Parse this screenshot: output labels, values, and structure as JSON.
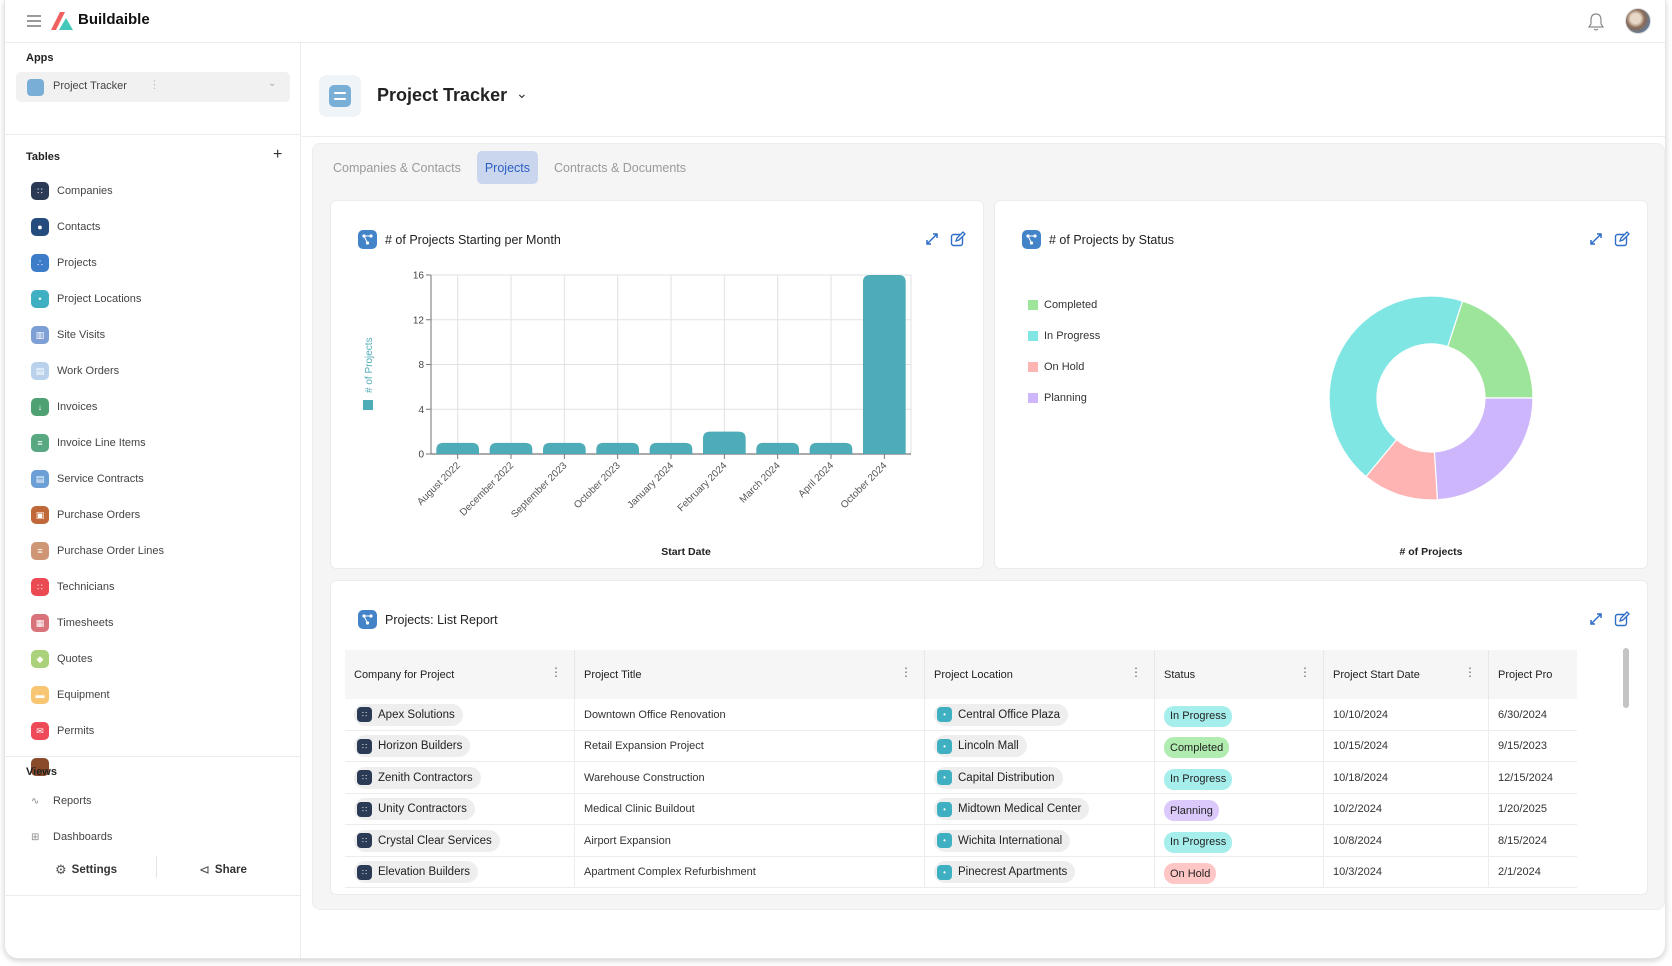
{
  "app": {
    "brand": "Buildaible",
    "colors": {
      "brand_red": "#f06060",
      "brand_teal": "#46c7bb",
      "accent": "#2f6ec6",
      "bar": "#4eabb8"
    }
  },
  "sidebar": {
    "apps_label": "Apps",
    "app_selector": {
      "label": "Project Tracker",
      "icon": "database-icon"
    },
    "tables_label": "Tables",
    "tables": [
      {
        "label": "Companies",
        "icon": "users-icon",
        "color": "#2b3a55",
        "glyph": "∷"
      },
      {
        "label": "Contacts",
        "icon": "person-icon",
        "color": "#244d7e",
        "glyph": "●"
      },
      {
        "label": "Projects",
        "icon": "diagram-icon",
        "color": "#3d7cc9",
        "glyph": "∴"
      },
      {
        "label": "Project Locations",
        "icon": "pin-icon",
        "color": "#3fb0c2",
        "glyph": "•"
      },
      {
        "label": "Site Visits",
        "icon": "building-icon",
        "color": "#7e9fd6",
        "glyph": "▥"
      },
      {
        "label": "Work Orders",
        "icon": "document-icon",
        "color": "#b9d1ea",
        "glyph": "▤"
      },
      {
        "label": "Invoices",
        "icon": "download-icon",
        "color": "#4fa072",
        "glyph": "↓"
      },
      {
        "label": "Invoice Line Items",
        "icon": "checklist-icon",
        "color": "#5aa882",
        "glyph": "≡"
      },
      {
        "label": "Service Contracts",
        "icon": "document-icon",
        "color": "#6b9fd6",
        "glyph": "▤"
      },
      {
        "label": "Purchase Orders",
        "icon": "cart-icon",
        "color": "#c0683a",
        "glyph": "▣"
      },
      {
        "label": "Purchase Order Lines",
        "icon": "checklist-icon",
        "color": "#cf9675",
        "glyph": "≡"
      },
      {
        "label": "Technicians",
        "icon": "users-icon",
        "color": "#ea4a52",
        "glyph": "∷"
      },
      {
        "label": "Timesheets",
        "icon": "calendar-icon",
        "color": "#d9737b",
        "glyph": "▦"
      },
      {
        "label": "Quotes",
        "icon": "tag-icon",
        "color": "#a9d27a",
        "glyph": "◆"
      },
      {
        "label": "Equipment",
        "icon": "car-icon",
        "color": "#f8c573",
        "glyph": "▬"
      },
      {
        "label": "Permits",
        "icon": "mail-icon",
        "color": "#ee4a57",
        "glyph": "✉"
      },
      {
        "label": "",
        "icon": "table-icon",
        "color": "#8a4b2a",
        "glyph": ""
      }
    ],
    "views_label": "Views",
    "views": [
      {
        "label": "Reports",
        "icon": "trend-icon",
        "glyph": "∿"
      },
      {
        "label": "Dashboards",
        "icon": "grid-icon",
        "glyph": "⊞"
      }
    ],
    "footer": {
      "settings": "Settings",
      "share": "Share"
    }
  },
  "main": {
    "title": "Project Tracker",
    "tabs": [
      {
        "label": "Companies & Contacts",
        "active": false
      },
      {
        "label": "Projects",
        "active": true
      },
      {
        "label": "Contracts & Documents",
        "active": false
      }
    ]
  },
  "chart_data": [
    {
      "type": "bar",
      "title": "# of Projects Starting per Month",
      "xlabel": "Start Date",
      "ylabel": "# of Projects",
      "legend": [
        "# of Projects"
      ],
      "legend_position": "left",
      "categories": [
        "August 2022",
        "December 2022",
        "September 2023",
        "October 2023",
        "January 2024",
        "February 2024",
        "March 2024",
        "April 2024",
        "October 2024"
      ],
      "values": [
        1,
        1,
        1,
        1,
        1,
        2,
        1,
        1,
        16
      ],
      "yticks": [
        0,
        4,
        8,
        12,
        16
      ],
      "ylim": [
        0,
        16
      ],
      "grid": true,
      "color": "#4eabb8"
    },
    {
      "type": "pie",
      "title": "# of Projects by Status",
      "xlabel": "# of Projects",
      "donut": true,
      "legend_position": "left",
      "slices": [
        {
          "label": "Completed",
          "value": 5,
          "color": "#9de59a"
        },
        {
          "label": "Planning",
          "value": 6,
          "color": "#cdb6fb"
        },
        {
          "label": "On Hold",
          "value": 3,
          "color": "#ffb4b4"
        },
        {
          "label": "In Progress",
          "value": 11,
          "color": "#80e6e4"
        }
      ],
      "legend": [
        {
          "label": "Completed",
          "color": "#9de59a"
        },
        {
          "label": "In Progress",
          "color": "#80e6e4"
        },
        {
          "label": "On Hold",
          "color": "#ffb4b4"
        },
        {
          "label": "Planning",
          "color": "#cdb6fb"
        }
      ]
    }
  ],
  "list_report": {
    "title": "Projects: List Report",
    "columns": [
      "Company for Project",
      "Project Title",
      "Project Location",
      "Status",
      "Project Start Date",
      "Project Pro"
    ],
    "rows": [
      {
        "company": "Apex Solutions",
        "title": "Downtown Office Renovation",
        "location": "Central Office Plaza",
        "status": "In Progress",
        "start": "10/10/2024",
        "next": "6/30/2024"
      },
      {
        "company": "Horizon Builders",
        "title": "Retail Expansion Project",
        "location": "Lincoln Mall",
        "status": "Completed",
        "start": "10/15/2024",
        "next": "9/15/2023"
      },
      {
        "company": "Zenith Contractors",
        "title": "Warehouse Construction",
        "location": "Capital Distribution",
        "status": "In Progress",
        "start": "10/18/2024",
        "next": "12/15/2024"
      },
      {
        "company": "Unity Contractors",
        "title": "Medical Clinic Buildout",
        "location": "Midtown Medical Center",
        "status": "Planning",
        "start": "10/2/2024",
        "next": "1/20/2025"
      },
      {
        "company": "Crystal Clear Services",
        "title": "Airport Expansion",
        "location": "Wichita International",
        "status": "In Progress",
        "start": "10/8/2024",
        "next": "8/15/2024"
      },
      {
        "company": "Elevation Builders",
        "title": "Apartment Complex Refurbishment",
        "location": "Pinecrest Apartments",
        "status": "On Hold",
        "start": "10/3/2024",
        "next": "2/1/2024"
      }
    ],
    "status_colors": {
      "In Progress": "#a6eeec",
      "Completed": "#b0ecb0",
      "Planning": "#dcc9fb",
      "On Hold": "#ffc6c6"
    }
  }
}
